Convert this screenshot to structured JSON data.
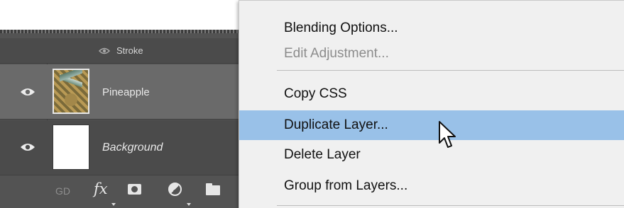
{
  "layers_panel": {
    "effect_row": {
      "label": "Stroke",
      "icon": "eye-icon"
    },
    "layers": [
      {
        "name": "Pineapple",
        "visible": true,
        "selected": true,
        "thumbnail": "pineapple-photo"
      },
      {
        "name": "Background",
        "visible": true,
        "selected": false,
        "thumbnail": "white-fill"
      }
    ],
    "toolbar": {
      "link_label": "GD",
      "fx_label": "fx",
      "icons": [
        "link-icon",
        "fx-icon",
        "layer-mask-icon",
        "adjustment-layer-icon",
        "folder-icon"
      ]
    }
  },
  "context_menu": {
    "items": [
      {
        "label": "Blending Options...",
        "enabled": true
      },
      {
        "label": "Edit Adjustment...",
        "enabled": false
      },
      {
        "label": "Copy CSS",
        "enabled": true
      },
      {
        "label": "Duplicate Layer...",
        "enabled": true,
        "highlighted": true
      },
      {
        "label": "Delete Layer",
        "enabled": true
      },
      {
        "label": "Group from Layers...",
        "enabled": true
      }
    ]
  },
  "colors": {
    "panel_bg": "#535353",
    "selected_row": "#6a6a6a",
    "menu_bg": "#f0f0f0",
    "menu_highlight": "#99c1e8",
    "disabled_text": "#8c8c8c"
  }
}
